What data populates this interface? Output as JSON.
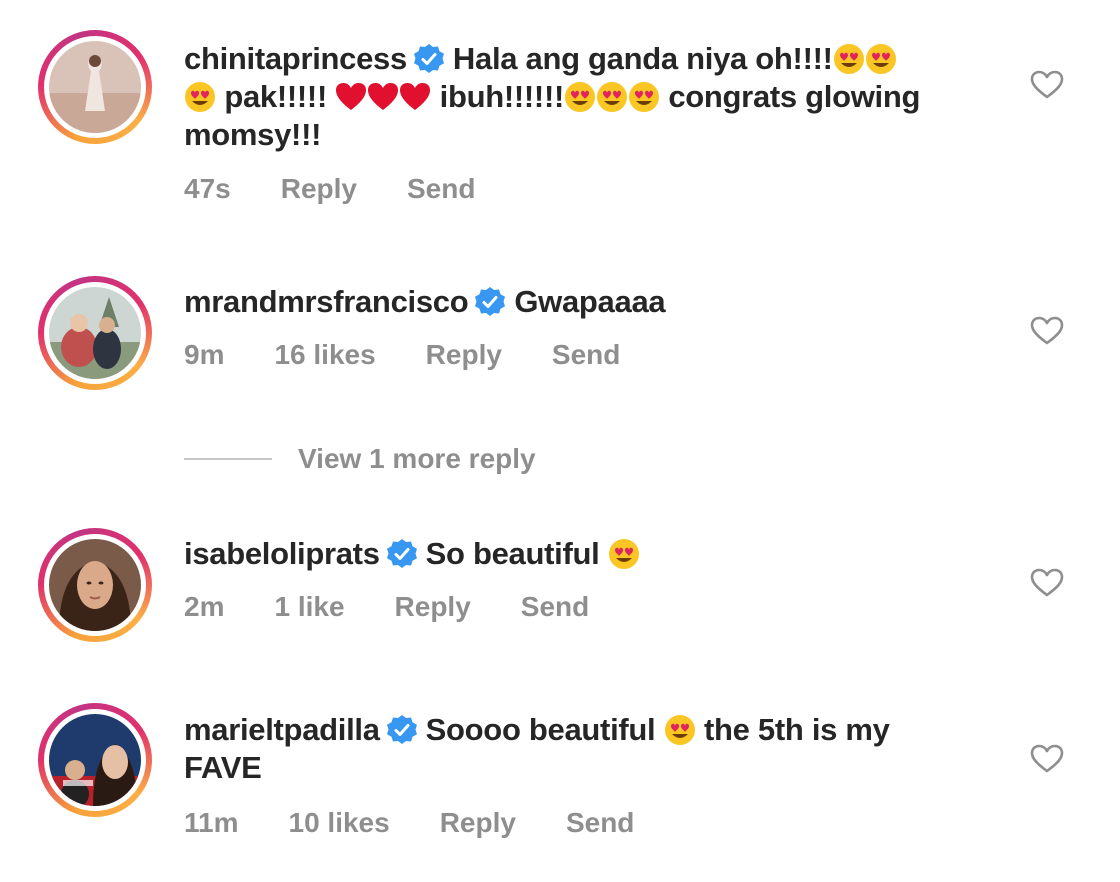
{
  "comments": [
    {
      "username": "chinitaprincess",
      "verified": true,
      "text_parts": [
        "Hala ang ganda niya oh!!!!",
        "pak!!!!!",
        "ibuh!!!!!!",
        "congrats glowing momsy!!!"
      ],
      "time": "47s",
      "likes": "",
      "reply_label": "Reply",
      "send_label": "Send"
    },
    {
      "username": "mrandmrsfrancisco",
      "verified": true,
      "text_parts": [
        "Gwapaaaa"
      ],
      "time": "9m",
      "likes": "16 likes",
      "reply_label": "Reply",
      "send_label": "Send"
    },
    {
      "username": "isabeloliprats",
      "verified": true,
      "text_parts": [
        "So beautiful"
      ],
      "time": "2m",
      "likes": "1 like",
      "reply_label": "Reply",
      "send_label": "Send"
    },
    {
      "username": "marieltpadilla",
      "verified": true,
      "text_parts": [
        "Soooo beautiful",
        "the 5th is my",
        "FAVE"
      ],
      "time": "11m",
      "likes": "10 likes",
      "reply_label": "Reply",
      "send_label": "Send"
    }
  ],
  "view_more_replies": "View 1 more reply",
  "colors": {
    "text": "#262626",
    "meta": "#8e8e8e",
    "verified": "#3897f0",
    "emoji_face": "#f9c623",
    "emoji_heart_eyes": "#e0245e",
    "heart": "#e0102e"
  },
  "icons": [
    "verified-badge-icon",
    "heart-eyes-emoji-icon",
    "red-heart-emoji-icon",
    "like-heart-outline-icon"
  ]
}
